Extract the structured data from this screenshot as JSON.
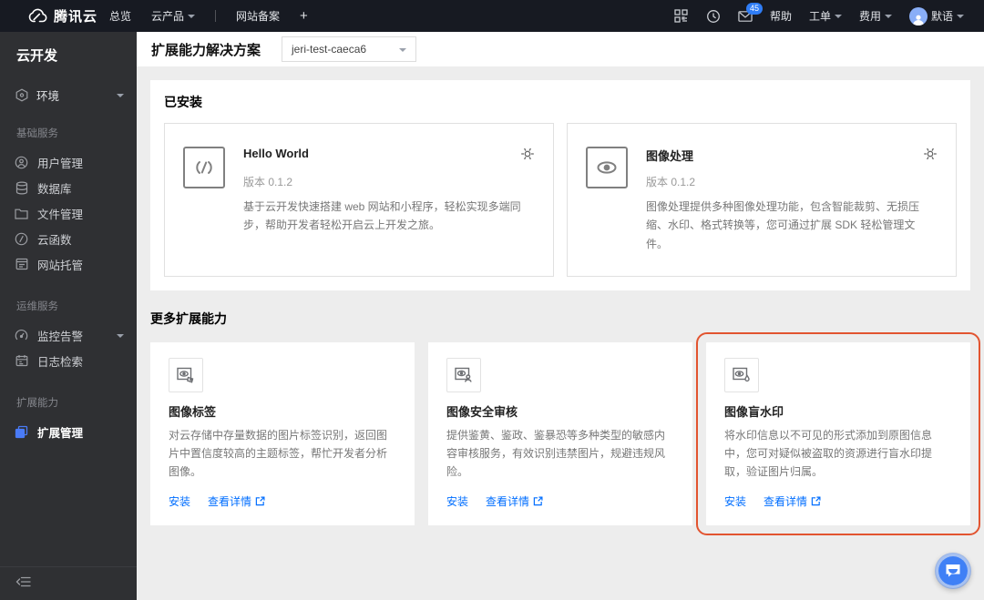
{
  "topbar": {
    "brand": "腾讯云",
    "nav": [
      {
        "label": "总览"
      },
      {
        "label": "云产品"
      },
      {
        "label": "网站备案"
      },
      {
        "label": "+"
      }
    ],
    "mail_badge": "45",
    "help": "帮助",
    "ticket": "工单",
    "billing": "费用",
    "username": "默语"
  },
  "sidebar": {
    "title": "云开发",
    "env_label": "环境",
    "sections": [
      {
        "label": "基础服务",
        "items": [
          {
            "label": "用户管理",
            "icon": "user-icon"
          },
          {
            "label": "数据库",
            "icon": "database-icon"
          },
          {
            "label": "文件管理",
            "icon": "folder-icon"
          },
          {
            "label": "云函数",
            "icon": "function-icon"
          },
          {
            "label": "网站托管",
            "icon": "hosting-icon"
          }
        ]
      },
      {
        "label": "运维服务",
        "items": [
          {
            "label": "监控告警",
            "icon": "gauge-icon"
          },
          {
            "label": "日志检索",
            "icon": "logs-icon"
          }
        ]
      },
      {
        "label": "扩展能力",
        "items": [
          {
            "label": "扩展管理",
            "icon": "extension-icon",
            "active": true
          }
        ]
      }
    ]
  },
  "header": {
    "title": "扩展能力解决方案",
    "env_value": "jeri-test-caeca6"
  },
  "installed": {
    "title": "已安装",
    "cards": [
      {
        "name": "Hello World",
        "version": "版本 0.1.2",
        "desc": "基于云开发快速搭建 web 网站和小程序，轻松实现多端同步，帮助开发者轻松开启云上开发之旅。",
        "icon": "code-icon"
      },
      {
        "name": "图像处理",
        "version": "版本 0.1.2",
        "desc": "图像处理提供多种图像处理功能，包含智能裁剪、无损压缩、水印、格式转换等，您可通过扩展 SDK 轻松管理文件。",
        "icon": "eye-icon"
      }
    ]
  },
  "more": {
    "title": "更多扩展能力",
    "install_label": "安装",
    "details_label": "查看详情",
    "cards": [
      {
        "name": "图像标签",
        "desc": "对云存储中存量数据的图片标签识别，返回图片中置信度较高的主题标签，帮忙开发者分析图像。",
        "icon": "image-tag-icon",
        "highlighted": false
      },
      {
        "name": "图像安全审核",
        "desc": "提供鉴黄、鉴政、鉴暴恐等多种类型的敏感内容审核服务，有效识别违禁图片，规避违规风险。",
        "icon": "image-audit-icon",
        "highlighted": false
      },
      {
        "name": "图像盲水印",
        "desc": "将水印信息以不可见的形式添加到原图信息中，您可对疑似被盗取的资源进行盲水印提取，验证图片归属。",
        "icon": "image-watermark-icon",
        "highlighted": true
      }
    ]
  },
  "colors": {
    "accent_blue": "#006eff",
    "highlight_orange": "#e25430",
    "topbar_bg": "#171a22",
    "sidebar_bg": "#2f3033",
    "badge_blue": "#2f7df6"
  }
}
